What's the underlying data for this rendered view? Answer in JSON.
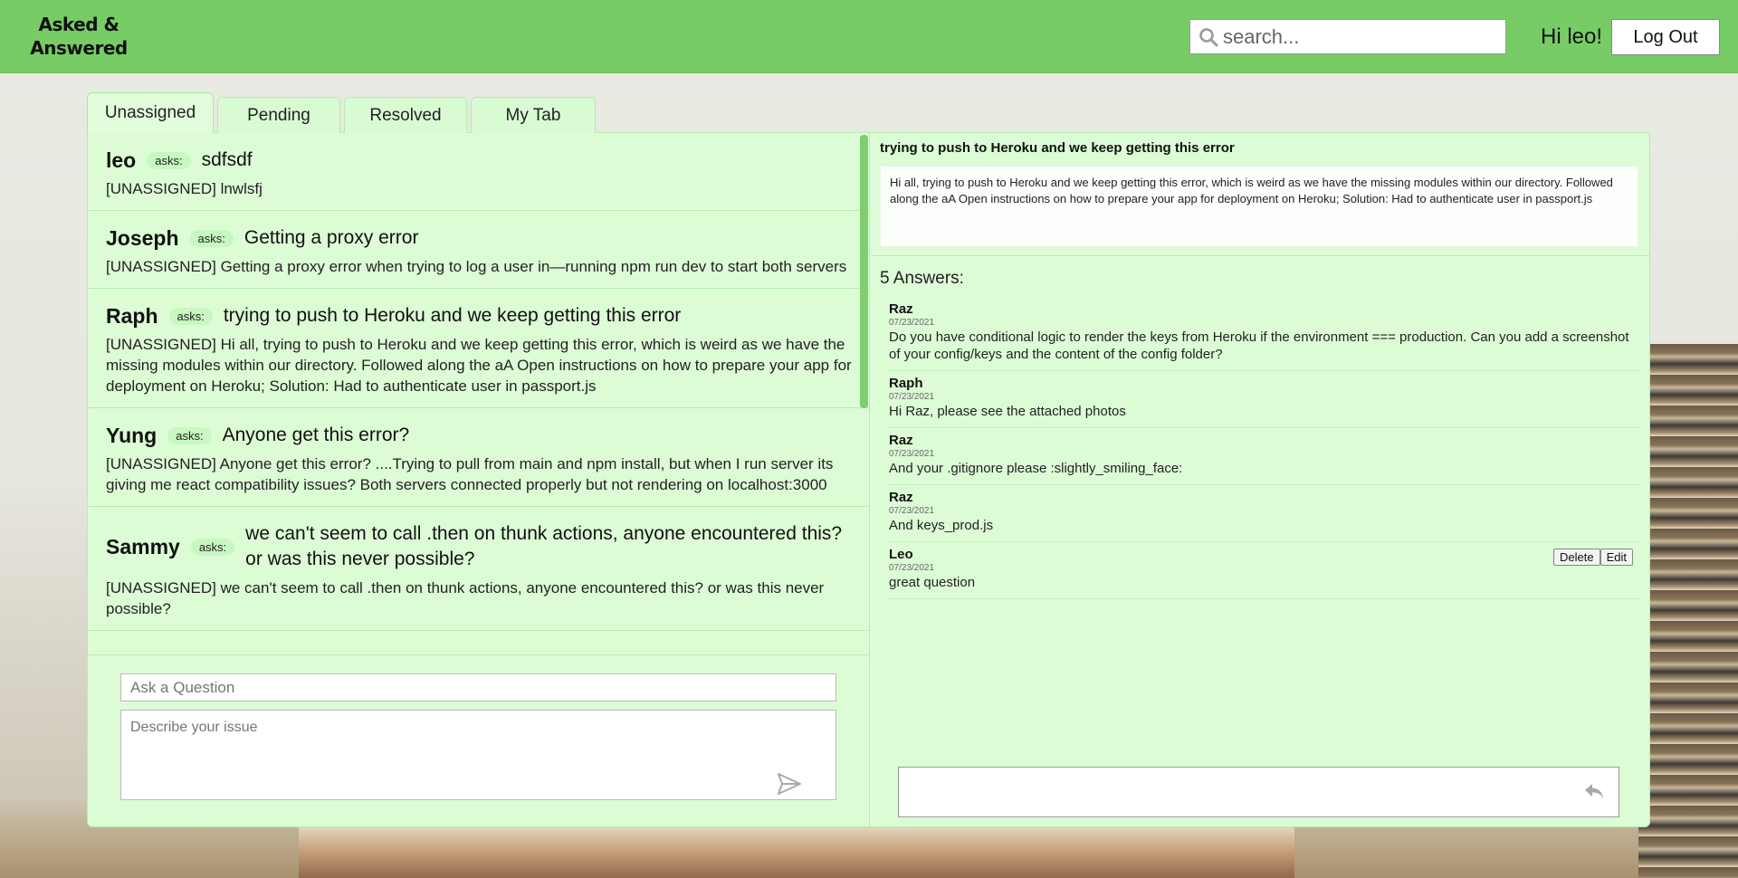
{
  "app": {
    "logo_line1": "Asked &",
    "logo_line2": "Answered"
  },
  "header": {
    "search_placeholder": "search...",
    "greeting": "Hi leo!",
    "logout_label": "Log Out"
  },
  "tabs": [
    {
      "label": "Unassigned",
      "active": true
    },
    {
      "label": "Pending"
    },
    {
      "label": "Resolved"
    },
    {
      "label": "My Tab"
    }
  ],
  "questions": [
    {
      "author": "leo",
      "asks": "asks:",
      "title": "sdfsdf",
      "body": "[UNASSIGNED] lnwlsfj"
    },
    {
      "author": "Joseph",
      "asks": "asks:",
      "title": "Getting a proxy error",
      "body": "[UNASSIGNED] Getting a proxy error when trying to log a user in—running npm run dev to start both servers"
    },
    {
      "author": "Raph",
      "asks": "asks:",
      "title": "trying to push to Heroku and we keep getting this error",
      "body": "[UNASSIGNED] Hi all, trying to push to Heroku and we keep getting this error, which is weird as we have the missing modules within our directory. Followed along the aA Open instructions on how to prepare your app for deployment on Heroku; Solution: Had to authenticate user in passport.js"
    },
    {
      "author": "Yung",
      "asks": "asks:",
      "title": "Anyone get this error?",
      "body": "[UNASSIGNED] Anyone get this error? ....Trying to pull from main and npm install, but when I run server its giving me react compatibility issues? Both servers connected properly but not rendering on localhost:3000"
    },
    {
      "author": "Sammy",
      "asks": "asks:",
      "title": "we can't seem to call .then on thunk actions, anyone encountered this? or was this never possible?",
      "body": "[UNASSIGNED] we can't seem to call .then on thunk actions, anyone encountered this? or was this never possible?"
    }
  ],
  "ask_form": {
    "title_placeholder": "Ask a Question",
    "description_placeholder": "Describe your issue"
  },
  "detail": {
    "title": "trying to push to Heroku and we keep getting this error",
    "body": "Hi all, trying to push to Heroku and we keep getting this error, which is weird as we have the missing modules within our directory. Followed along the aA Open instructions on how to prepare your app for deployment on Heroku; Solution: Had to authenticate user in passport.js",
    "answers_count": "5 Answers:",
    "answers": [
      {
        "author": "Raz",
        "date": "07/23/2021",
        "text": "Do you have conditional logic to render the keys from Heroku if the environment === production. Can you add a screenshot of your config/keys and the content of the config folder?"
      },
      {
        "author": "Raph",
        "date": "07/23/2021",
        "text": "Hi Raz, please see the attached photos"
      },
      {
        "author": "Raz",
        "date": "07/23/2021",
        "text": "And your .gitignore please :slightly_smiling_face:"
      },
      {
        "author": "Raz",
        "date": "07/23/2021",
        "text": "And keys_prod.js"
      },
      {
        "author": "Leo",
        "date": "07/23/2021",
        "text": "great question",
        "delete_label": "Delete",
        "edit_label": "Edit"
      }
    ]
  },
  "colors": {
    "header_bg": "#77cc66",
    "panel_bg": "#dcfcd6",
    "accent": "#7fcf71"
  },
  "icons": {
    "search": "search-icon",
    "send": "send-icon",
    "reply": "reply-icon"
  }
}
